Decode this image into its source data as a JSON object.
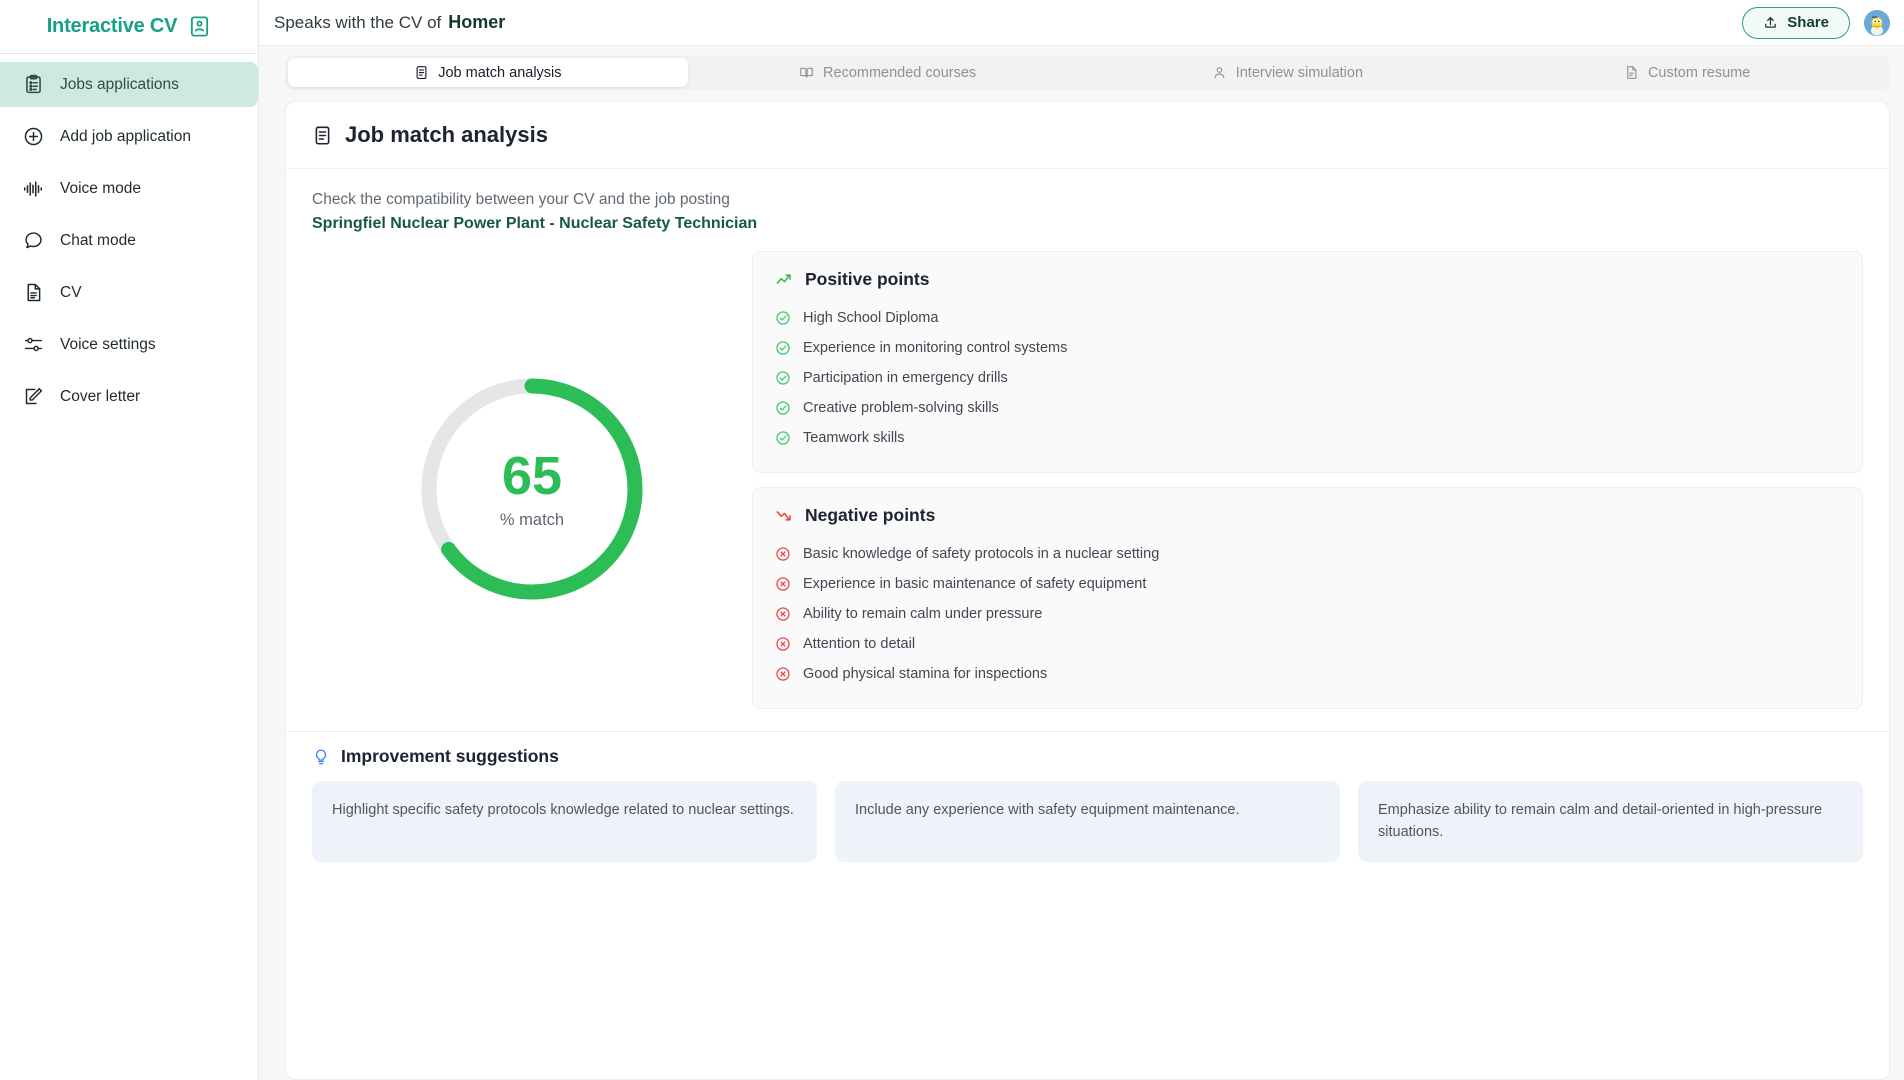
{
  "sidebar": {
    "brand": {
      "text": "Interactive CV",
      "icon": "id-card-icon"
    },
    "items": [
      {
        "label": "Jobs applications",
        "icon": "clipboard-list-icon",
        "active": true
      },
      {
        "label": "Add job application",
        "icon": "plus-circle-icon",
        "active": false
      },
      {
        "label": "Voice mode",
        "icon": "audio-waveform-icon",
        "active": false
      },
      {
        "label": "Chat mode",
        "icon": "chat-bubble-icon",
        "active": false
      },
      {
        "label": "CV",
        "icon": "document-icon",
        "active": false
      },
      {
        "label": "Voice settings",
        "icon": "sliders-icon",
        "active": false
      },
      {
        "label": "Cover letter",
        "icon": "pencil-square-icon",
        "active": false
      }
    ]
  },
  "topbar": {
    "prefix": "Speaks with the CV of",
    "name": "Homer",
    "share_label": "Share",
    "share_icon": "upload-icon",
    "avatar": "homer-avatar"
  },
  "tabs": [
    {
      "label": "Job match analysis",
      "icon": "document-text-icon",
      "active": true
    },
    {
      "label": "Recommended courses",
      "icon": "open-book-icon",
      "active": false
    },
    {
      "label": "Interview simulation",
      "icon": "person-icon",
      "active": false
    },
    {
      "label": "Custom resume",
      "icon": "file-icon",
      "active": false
    }
  ],
  "main": {
    "title": "Job match analysis",
    "title_icon": "document-text-icon",
    "subtitle": "Check the compatibility between your CV and the job posting",
    "job": "Springfiel Nuclear Power Plant - Nuclear Safety Technician"
  },
  "gauge": {
    "value": "65",
    "label": "% match",
    "percent": 65,
    "track_color": "#e4e6e8",
    "fill_color": "#2dbd57"
  },
  "positive": {
    "title": "Positive points",
    "icon": "trending-up-icon",
    "items": [
      "High School Diploma",
      "Experience in monitoring control systems",
      "Participation in emergency drills",
      "Creative problem-solving skills",
      "Teamwork skills"
    ]
  },
  "negative": {
    "title": "Negative points",
    "icon": "trending-down-icon",
    "items": [
      "Basic knowledge of safety protocols in a nuclear setting",
      "Experience in basic maintenance of safety equipment",
      "Ability to remain calm under pressure",
      "Attention to detail",
      "Good physical stamina for inspections"
    ]
  },
  "suggestions": {
    "title": "Improvement suggestions",
    "icon": "lightbulb-icon",
    "items": [
      "Highlight specific safety protocols knowledge related to nuclear settings.",
      "Include any experience with safety equipment maintenance.",
      "Emphasize ability to remain calm and detail-oriented in high-pressure situations."
    ]
  },
  "colors": {
    "brand": "#17a085",
    "accent_green": "#2dbd57",
    "negative_red": "#ef4444",
    "sidebar_active_bg": "#cfe8e0",
    "suggestion_bg": "#eef3f9"
  }
}
